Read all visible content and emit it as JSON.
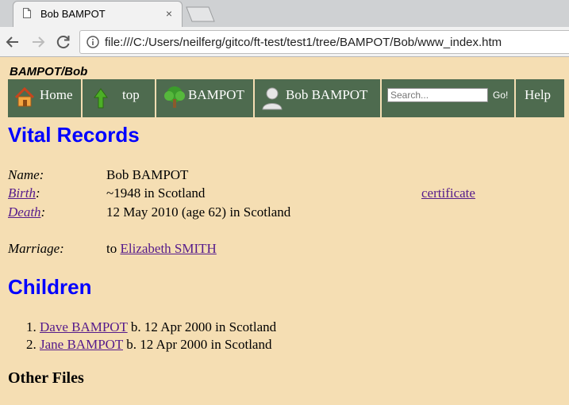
{
  "browser": {
    "tab_title": "Bob BAMPOT",
    "tab_close": "×",
    "url": "file:///C:/Users/neilferg/gitco/ft-test/test1/tree/BAMPOT/Bob/www_index.htm"
  },
  "page": {
    "breadcrumb": "BAMPOT/Bob",
    "nav": {
      "home": "Home",
      "top": "top",
      "surname": "BAMPOT",
      "person": "Bob BAMPOT",
      "search_placeholder": "Search...",
      "go": "Go!",
      "help": "Help"
    },
    "vital_heading": "Vital Records",
    "records": {
      "name_label": "Name",
      "name_value": "Bob BAMPOT",
      "birth_label": "Birth",
      "birth_value": "~1948 in Scotland",
      "certificate": "certificate",
      "death_label": "Death",
      "death_value": "12 May 2010 (age 62) in Scotland",
      "marriage_label": "Marriage:",
      "marriage_prefix": "to",
      "spouse": "Elizabeth SMITH"
    },
    "children_heading": "Children",
    "children": [
      {
        "num": "1.",
        "name": "Dave BAMPOT",
        "details": "b. 12 Apr 2000 in Scotland"
      },
      {
        "num": "2.",
        "name": "Jane BAMPOT",
        "details": "b. 12 Apr 2000 in Scotland"
      }
    ],
    "other_files_heading": "Other Files"
  },
  "colors": {
    "page_background": "#f5deb3",
    "navbar": "#4e6b4f",
    "heading": "#0000ff",
    "link": "#551a8b"
  }
}
